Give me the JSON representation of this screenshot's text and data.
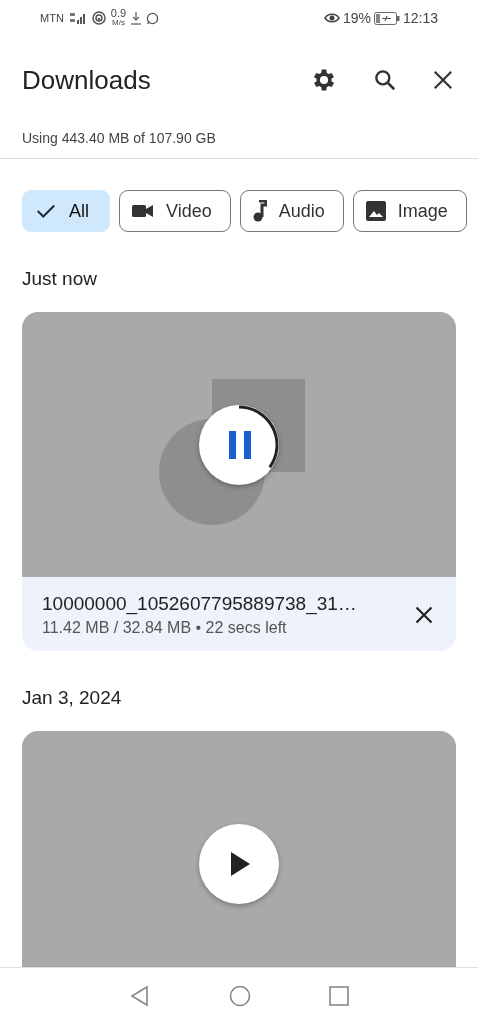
{
  "status_bar": {
    "carrier": "MTN",
    "speed_value": "0.9",
    "speed_unit": "M/s",
    "battery": "19%",
    "time": "12:13"
  },
  "header": {
    "title": "Downloads"
  },
  "storage": "Using 443.40 MB of 107.90 GB",
  "filters": [
    {
      "label": "All",
      "kind": "all",
      "selected": true
    },
    {
      "label": "Video",
      "kind": "video",
      "selected": false
    },
    {
      "label": "Audio",
      "kind": "audio",
      "selected": false
    },
    {
      "label": "Image",
      "kind": "images",
      "selected": false
    }
  ],
  "sections": [
    {
      "heading": "Just now",
      "items": [
        {
          "kind": "downloading",
          "name": "10000000_1052607795889738_31…",
          "detail": "11.42 MB / 32.84 MB • 22 secs left"
        }
      ]
    },
    {
      "heading": "Jan 3, 2024",
      "items": [
        {
          "kind": "video"
        }
      ]
    }
  ]
}
